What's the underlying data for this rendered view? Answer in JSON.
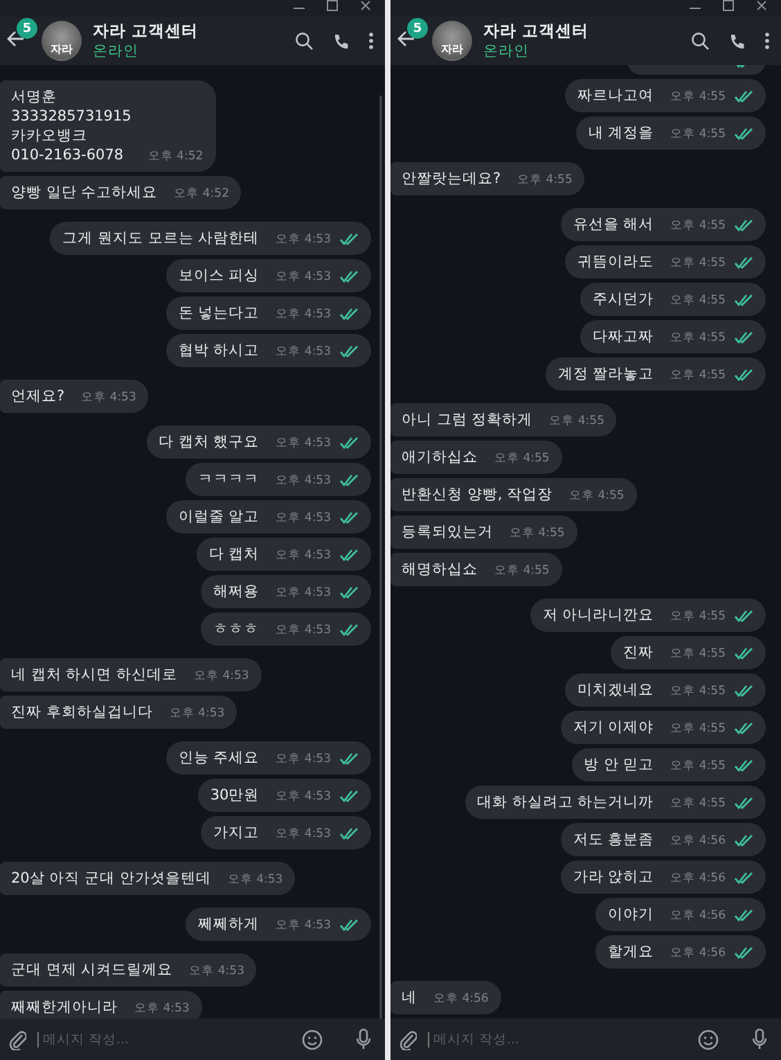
{
  "panels": [
    {
      "header": {
        "unread_badge": "5",
        "avatar_text": "자라",
        "title": "자라 고객센터",
        "status": "온라인"
      },
      "messages": [
        {
          "kind": "in",
          "text": "서명훈\n3333285731915\n 카카오뱅크\n010-2163-6078",
          "time": "오후 4:52"
        },
        {
          "kind": "in",
          "text": "양빵 일단 수고하세요",
          "time": "오후 4:52"
        },
        {
          "kind": "out",
          "text": "그게 뭔지도 모르는 사람한테",
          "time": "오후 4:53",
          "read": true
        },
        {
          "kind": "out",
          "text": "보이스 피싱",
          "time": "오후 4:53",
          "read": true
        },
        {
          "kind": "out",
          "text": "돈 넣는다고",
          "time": "오후 4:53",
          "read": true
        },
        {
          "kind": "out",
          "text": "협박 하시고",
          "time": "오후 4:53",
          "read": true
        },
        {
          "kind": "in",
          "text": "언제요?",
          "time": "오후 4:53"
        },
        {
          "kind": "out",
          "text": "다 캡처 했구요",
          "time": "오후 4:53",
          "read": true
        },
        {
          "kind": "out",
          "text": "ㅋㅋㅋㅋ",
          "time": "오후 4:53",
          "read": true
        },
        {
          "kind": "out",
          "text": "이럴줄 알고",
          "time": "오후 4:53",
          "read": true
        },
        {
          "kind": "out",
          "text": "다 캡처",
          "time": "오후 4:53",
          "read": true
        },
        {
          "kind": "out",
          "text": "해쩌용",
          "time": "오후 4:53",
          "read": true
        },
        {
          "kind": "out",
          "text": "ㅎㅎㅎ",
          "time": "오후 4:53",
          "read": true
        },
        {
          "kind": "in",
          "text": "네 캡처 하시면 하신데로",
          "time": "오후 4:53"
        },
        {
          "kind": "in",
          "text": "진짜 후회하실겁니다",
          "time": "오후 4:53"
        },
        {
          "kind": "out",
          "text": "인능 주세요",
          "time": "오후 4:53",
          "read": true
        },
        {
          "kind": "out",
          "text": "30만원",
          "time": "오후 4:53",
          "read": true
        },
        {
          "kind": "out",
          "text": "가지고",
          "time": "오후 4:53",
          "read": true
        },
        {
          "kind": "in",
          "text": "20살 아직 군대 안가셧을텐데",
          "time": "오후 4:53"
        },
        {
          "kind": "out",
          "text": "쩨쩨하게",
          "time": "오후 4:53",
          "read": true
        },
        {
          "kind": "in",
          "text": "군대 면제 시켜드릴께요",
          "time": "오후 4:53"
        },
        {
          "kind": "in",
          "text": "째째한게아니라",
          "time": "오후 4:53"
        }
      ],
      "composer": {
        "placeholder": "메시지 작성..."
      }
    },
    {
      "header": {
        "unread_badge": "5",
        "avatar_text": "자라",
        "title": "자라 고객센터",
        "status": "온라인"
      },
      "messages": [
        {
          "kind": "cut",
          "read": true
        },
        {
          "kind": "out",
          "text": "짜르나고여",
          "time": "오후 4:55",
          "read": true
        },
        {
          "kind": "out",
          "text": "내 계정을",
          "time": "오후 4:55",
          "read": true
        },
        {
          "kind": "in",
          "text": "안짤랏는데요?",
          "time": "오후 4:55"
        },
        {
          "kind": "out",
          "text": "유선을 해서",
          "time": "오후 4:55",
          "read": true
        },
        {
          "kind": "out",
          "text": "귀뜸이라도",
          "time": "오후 4:55",
          "read": true
        },
        {
          "kind": "out",
          "text": "주시던가",
          "time": "오후 4:55",
          "read": true
        },
        {
          "kind": "out",
          "text": "다짜고짜",
          "time": "오후 4:55",
          "read": true
        },
        {
          "kind": "out",
          "text": "계정 짤라놓고",
          "time": "오후 4:55",
          "read": true
        },
        {
          "kind": "in",
          "text": "아니 그럼 정확하게",
          "time": "오후 4:55"
        },
        {
          "kind": "in",
          "text": "애기하십쇼",
          "time": "오후 4:55"
        },
        {
          "kind": "in",
          "text": "반환신청 양빵, 작업장",
          "time": "오후 4:55"
        },
        {
          "kind": "in",
          "text": "등록되있는거",
          "time": "오후 4:55"
        },
        {
          "kind": "in",
          "text": "해명하십쇼",
          "time": "오후 4:55"
        },
        {
          "kind": "out",
          "text": "저 아니라니깐요",
          "time": "오후 4:55",
          "read": true
        },
        {
          "kind": "out",
          "text": "진짜",
          "time": "오후 4:55",
          "read": true
        },
        {
          "kind": "out",
          "text": "미치겠네요",
          "time": "오후 4:55",
          "read": true
        },
        {
          "kind": "out",
          "text": "저기 이제야",
          "time": "오후 4:55",
          "read": true
        },
        {
          "kind": "out",
          "text": "방 안 믿고",
          "time": "오후 4:55",
          "read": true
        },
        {
          "kind": "out",
          "text": "대화 하실려고 하는거니까",
          "time": "오후 4:55",
          "read": true
        },
        {
          "kind": "out",
          "text": "저도 흥분좀",
          "time": "오후 4:56",
          "read": true
        },
        {
          "kind": "out",
          "text": "가라 앉히고",
          "time": "오후 4:56",
          "read": true
        },
        {
          "kind": "out",
          "text": "이야기",
          "time": "오후 4:56",
          "read": true
        },
        {
          "kind": "out",
          "text": "할게요",
          "time": "오후 4:56",
          "read": true
        },
        {
          "kind": "in",
          "text": "네",
          "time": "오후 4:56"
        }
      ],
      "composer": {
        "placeholder": "메시지 작성..."
      }
    }
  ]
}
